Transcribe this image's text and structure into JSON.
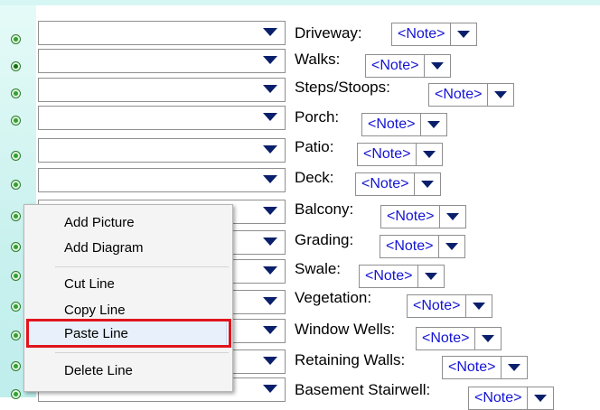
{
  "rows": [
    {
      "label": "Driveway:",
      "note": "<Note>"
    },
    {
      "label": "Walks:",
      "note": "<Note>"
    },
    {
      "label": "Steps/Stoops:",
      "note": "<Note>"
    },
    {
      "label": "Porch:",
      "note": "<Note>"
    },
    {
      "label": "Patio:",
      "note": "<Note>"
    },
    {
      "label": "Deck:",
      "note": "<Note>"
    },
    {
      "label": "Balcony:",
      "note": "<Note>"
    },
    {
      "label": "Grading:",
      "note": "<Note>"
    },
    {
      "label": "Swale:",
      "note": "<Note>"
    },
    {
      "label": "Vegetation:",
      "note": "<Note>"
    },
    {
      "label": "Window Wells:",
      "note": "<Note>"
    },
    {
      "label": "Retaining Walls:",
      "note": "<Note>"
    },
    {
      "label": "Basement Stairwell:",
      "note": "<Note>"
    }
  ],
  "context_menu": {
    "items": [
      "Add Picture",
      "Add Diagram",
      "Cut Line",
      "Copy Line",
      "Paste Line",
      "Delete Line"
    ],
    "highlighted": "Paste Line"
  }
}
